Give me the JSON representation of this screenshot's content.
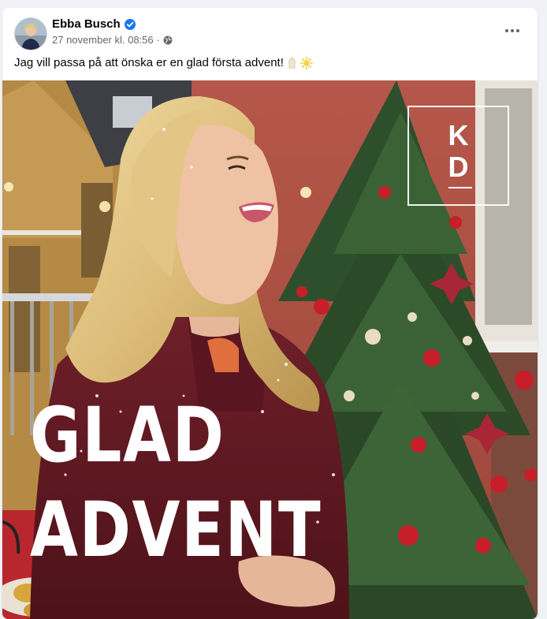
{
  "post": {
    "author": "Ebba Busch",
    "timestamp": "27 november kl. 08:56",
    "separator": "·",
    "audience_icon": "globe-icon",
    "verified_icon": "verified-badge-icon",
    "text": "Jag vill passa på att önska er en glad första advent!",
    "emojis": [
      "candle-emoji",
      "sun-emoji"
    ],
    "menu_icon": "more-options-icon"
  },
  "image": {
    "overlay_line1": "GLAD",
    "overlay_line2": "ADVENT",
    "logo_letter1": "K",
    "logo_letter2": "D"
  },
  "colors": {
    "verified": "#1877f2",
    "meta_text": "#65676b",
    "primary_text": "#050505"
  }
}
